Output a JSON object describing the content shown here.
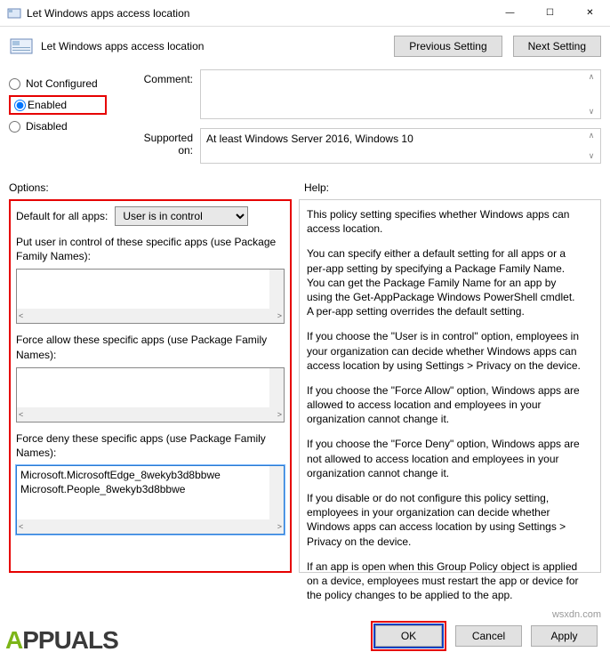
{
  "window": {
    "title": "Let Windows apps access location",
    "minimize": "—",
    "maximize": "☐",
    "close": "✕"
  },
  "header": {
    "title": "Let Windows apps access location",
    "prev": "Previous Setting",
    "next": "Next Setting"
  },
  "radios": {
    "not_configured": "Not Configured",
    "enabled": "Enabled",
    "disabled": "Disabled"
  },
  "fields": {
    "comment_label": "Comment:",
    "comment_value": "",
    "supported_label": "Supported on:",
    "supported_value": "At least Windows Server 2016, Windows 10"
  },
  "sections": {
    "options": "Options:",
    "help": "Help:"
  },
  "options": {
    "default_label": "Default for all apps:",
    "default_value": "User is in control",
    "put_user_label": "Put user in control of these specific apps (use Package Family Names):",
    "put_user_value": "",
    "force_allow_label": "Force allow these specific apps (use Package Family Names):",
    "force_allow_value": "",
    "force_deny_label": "Force deny these specific apps (use Package Family Names):",
    "force_deny_value": "Microsoft.MicrosoftEdge_8wekyb3d8bbwe\nMicrosoft.People_8wekyb3d8bbwe"
  },
  "help": {
    "p1": "This policy setting specifies whether Windows apps can access location.",
    "p2": "You can specify either a default setting for all apps or a per-app setting by specifying a Package Family Name. You can get the Package Family Name for an app by using the Get-AppPackage Windows PowerShell cmdlet. A per-app setting overrides the default setting.",
    "p3": "If you choose the \"User is in control\" option, employees in your organization can decide whether Windows apps can access location by using Settings > Privacy on the device.",
    "p4": "If you choose the \"Force Allow\" option, Windows apps are allowed to access location and employees in your organization cannot change it.",
    "p5": "If you choose the \"Force Deny\" option, Windows apps are not allowed to access location and employees in your organization cannot change it.",
    "p6": "If you disable or do not configure this policy setting, employees in your organization can decide whether Windows apps can access location by using Settings > Privacy on the device.",
    "p7": "If an app is open when this Group Policy object is applied on a device, employees must restart the app or device for the policy changes to be applied to the app."
  },
  "footer": {
    "ok": "OK",
    "cancel": "Cancel",
    "apply": "Apply"
  },
  "watermark": {
    "brand_a": "A",
    "brand_rest": "PPUALS",
    "site": "wsxdn.com"
  }
}
